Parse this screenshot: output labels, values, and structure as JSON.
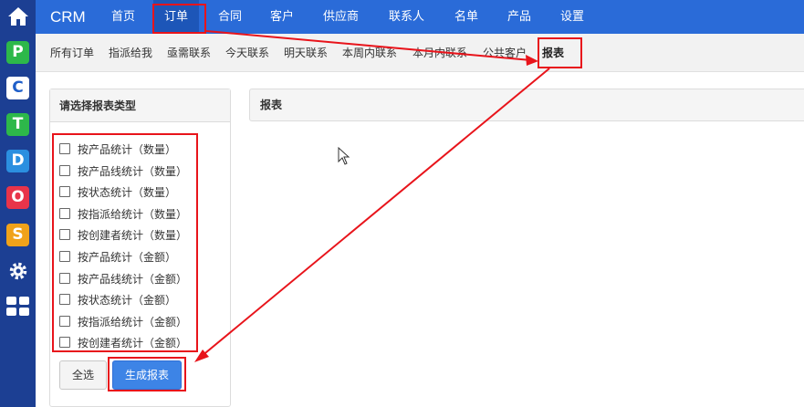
{
  "brand": "CRM",
  "nav": [
    "首页",
    "订单",
    "合同",
    "客户",
    "供应商",
    "联系人",
    "名单",
    "产品",
    "设置"
  ],
  "nav_active": "订单",
  "subnav": [
    "所有订单",
    "指派给我",
    "亟需联系",
    "今天联系",
    "明天联系",
    "本周内联系",
    "本月内联系",
    "公共客户",
    "报表"
  ],
  "subnav_active": "报表",
  "rail": [
    {
      "icon": "home-icon"
    },
    {
      "icon": "p-app-icon",
      "glyph": "P",
      "color": "#2db84a"
    },
    {
      "icon": "c-app-icon",
      "glyph": "C",
      "color": "#1f5fc9"
    },
    {
      "icon": "t-app-icon",
      "glyph": "T",
      "color": "#2db84a"
    },
    {
      "icon": "d-app-icon",
      "glyph": "D",
      "color": "#2b8fe0"
    },
    {
      "icon": "o-app-icon",
      "glyph": "O",
      "color": "#e8344a"
    },
    {
      "icon": "s-app-icon",
      "glyph": "S",
      "color": "#f0a21a"
    },
    {
      "icon": "gear-icon"
    },
    {
      "icon": "grid-icon"
    }
  ],
  "panel": {
    "title": "请选择报表类型",
    "options": [
      "按产品统计（数量）",
      "按产品线统计（数量）",
      "按状态统计（数量）",
      "按指派给统计（数量）",
      "按创建者统计（数量）",
      "按产品统计（金额）",
      "按产品线统计（金额）",
      "按状态统计（金额）",
      "按指派给统计（金额）",
      "按创建者统计（金额）"
    ],
    "select_all": "全选",
    "generate": "生成报表"
  },
  "report": {
    "title": "报表"
  },
  "colors": {
    "topnav": "#2a6bd8",
    "rail": "#1c3f93",
    "annotation": "#e8141b",
    "primary_button": "#3d84e6"
  }
}
